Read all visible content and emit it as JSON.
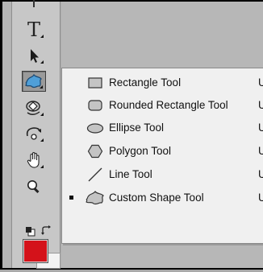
{
  "tools": {
    "type_glyph": "T"
  },
  "colors": {
    "foreground": "#d4121a",
    "background": "#f3f3f3",
    "active_tool_icon": "#4f9fd8"
  },
  "flyout": {
    "items": [
      {
        "label": "Rectangle Tool",
        "shortcut": "U",
        "icon": "rectangle-icon",
        "selected": false
      },
      {
        "label": "Rounded Rectangle Tool",
        "shortcut": "U",
        "icon": "rounded-rectangle-icon",
        "selected": false
      },
      {
        "label": "Ellipse Tool",
        "shortcut": "U",
        "icon": "ellipse-icon",
        "selected": false
      },
      {
        "label": "Polygon Tool",
        "shortcut": "U",
        "icon": "polygon-icon",
        "selected": false
      },
      {
        "label": "Line Tool",
        "shortcut": "U",
        "icon": "line-icon",
        "selected": false
      },
      {
        "label": "Custom Shape Tool",
        "shortcut": "U",
        "icon": "custom-shape-icon",
        "selected": true
      }
    ]
  }
}
